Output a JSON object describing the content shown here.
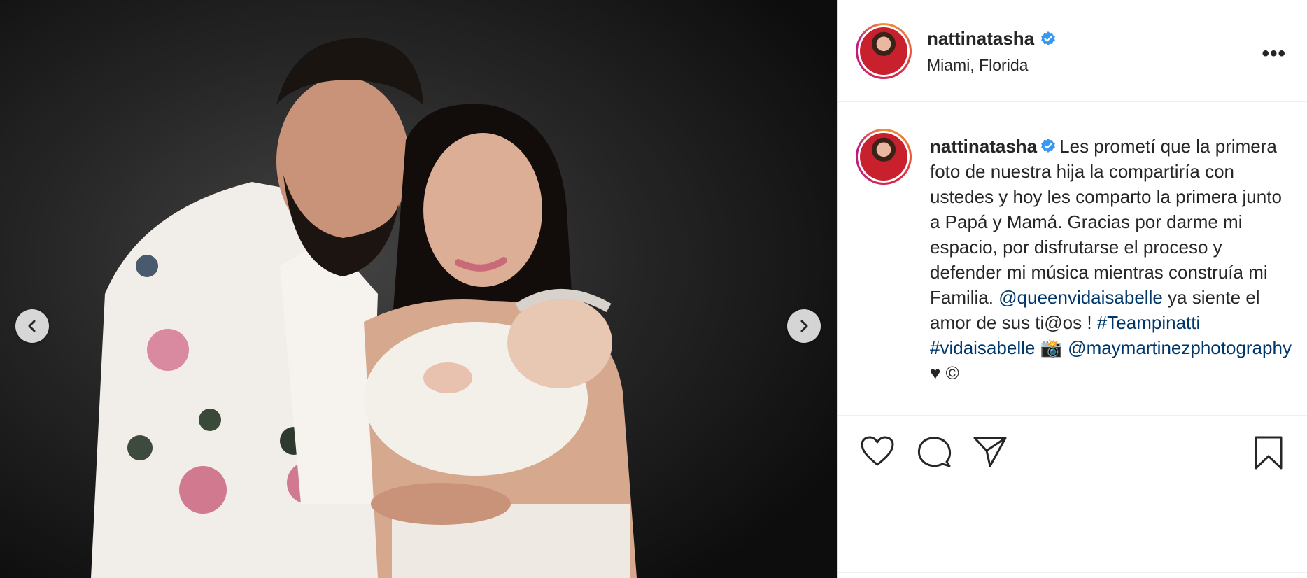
{
  "post": {
    "username": "nattinatasha",
    "location": "Miami, Florida",
    "caption": {
      "username": "nattinatasha",
      "text_1": "Les prometí que la primera foto de nuestra hija la compartiría con ustedes y hoy les comparto la primera junto a Papá y Mamá. Gracias por darme mi espacio, por disfrutarse el proceso y defender mi música mientras construía mi Familia.",
      "mention_1": "@queenvidaisabelle",
      "text_2": "ya siente el amor de sus ti@os !",
      "hashtag_1": "#Teampinatti",
      "hashtag_2": "#vidaisabelle",
      "emoji_camera": "📸",
      "mention_2": "@maymartinezphotography",
      "trailing": "♥ ©"
    }
  },
  "icons": {
    "verified": "verified-badge-icon",
    "more": "more-options-icon",
    "like": "heart-icon",
    "comment": "comment-icon",
    "share": "share-icon",
    "save": "bookmark-icon",
    "prev": "chevron-left-icon",
    "next": "chevron-right-icon"
  },
  "more_label": "•••",
  "colors": {
    "link": "#00376b",
    "verified": "#3897f0",
    "text": "#262626",
    "border": "#dbdbdb"
  }
}
